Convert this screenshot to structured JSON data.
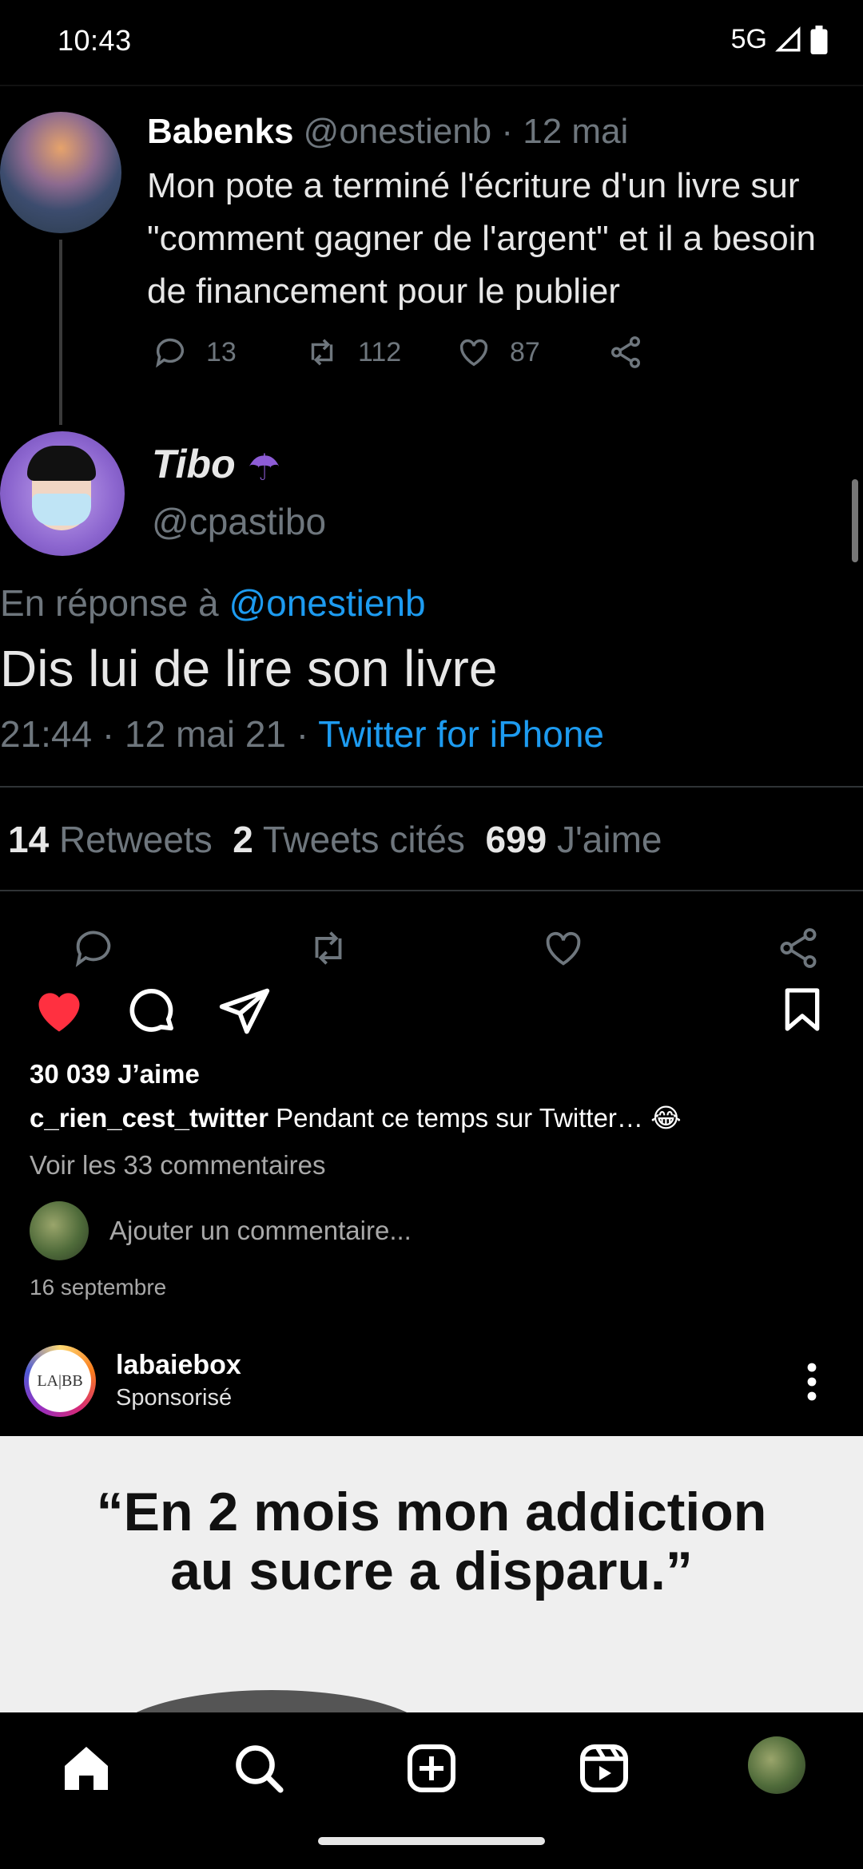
{
  "status_bar": {
    "time": "10:43",
    "network": "5G"
  },
  "tweet": {
    "original": {
      "name": "Babenks",
      "handle": "@onestienb",
      "date": "· 12 mai",
      "lines": [
        "Mon pote a terminé l'écriture d'un livre sur",
        "\"comment gagner de l'argent\" et il a besoin",
        "de financement pour le publier"
      ],
      "replies": "13",
      "retweets": "112",
      "likes": "87"
    },
    "reply": {
      "name": "Tibo",
      "handle": "@cpastibo",
      "in_reply_prefix": "En réponse à",
      "in_reply_handle": "@onestienb",
      "text": "Dis lui de lire son livre",
      "datetime": "21:44 · 12 mai 21 ·",
      "source": "Twitter for iPhone",
      "retweets_count": "14",
      "retweets_label": "Retweets",
      "quotes_count": "2",
      "quotes_label": "Tweets cités",
      "likes_count": "699",
      "likes_label": "J'aime"
    }
  },
  "post": {
    "likes": "30 039 J’aime",
    "username": "c_rien_cest_twitter",
    "caption": "Pendant ce temps sur Twitter… 😂",
    "view_comments": "Voir les 33 commentaires",
    "comment_placeholder": "Ajouter un commentaire...",
    "date": "16 septembre"
  },
  "sponsored": {
    "account": "labaiebox",
    "label": "Sponsorisé",
    "logo_text": "LA|BB",
    "ad_line1": "“En 2 mois mon addiction",
    "ad_line2": "au sucre a disparu.”"
  },
  "colors": {
    "like_red": "#ff3040",
    "twitter_blue": "#1d9bf0",
    "muted": "#a8a8a8"
  },
  "icons": [
    "home-icon",
    "search-icon",
    "create-icon",
    "reels-icon",
    "profile-avatar"
  ]
}
